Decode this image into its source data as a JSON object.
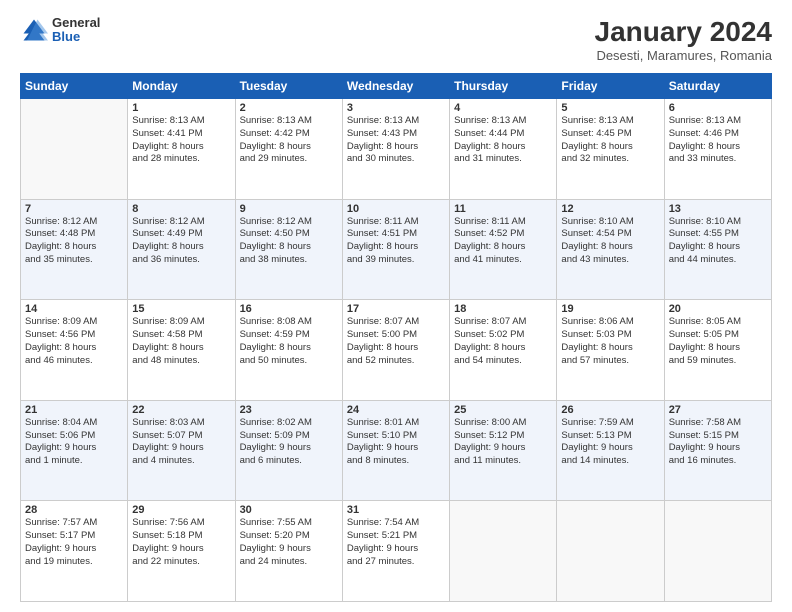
{
  "logo": {
    "general": "General",
    "blue": "Blue"
  },
  "title": "January 2024",
  "subtitle": "Desesti, Maramures, Romania",
  "weekdays": [
    "Sunday",
    "Monday",
    "Tuesday",
    "Wednesday",
    "Thursday",
    "Friday",
    "Saturday"
  ],
  "weeks": [
    [
      {
        "empty": true
      },
      {
        "day": "1",
        "sunrise": "8:13 AM",
        "sunset": "4:41 PM",
        "daylight": "8 hours and 28 minutes."
      },
      {
        "day": "2",
        "sunrise": "8:13 AM",
        "sunset": "4:42 PM",
        "daylight": "8 hours and 29 minutes."
      },
      {
        "day": "3",
        "sunrise": "8:13 AM",
        "sunset": "4:43 PM",
        "daylight": "8 hours and 30 minutes."
      },
      {
        "day": "4",
        "sunrise": "8:13 AM",
        "sunset": "4:44 PM",
        "daylight": "8 hours and 31 minutes."
      },
      {
        "day": "5",
        "sunrise": "8:13 AM",
        "sunset": "4:45 PM",
        "daylight": "8 hours and 32 minutes."
      },
      {
        "day": "6",
        "sunrise": "8:13 AM",
        "sunset": "4:46 PM",
        "daylight": "8 hours and 33 minutes."
      }
    ],
    [
      {
        "day": "7",
        "sunrise": "8:12 AM",
        "sunset": "4:48 PM",
        "daylight": "8 hours and 35 minutes."
      },
      {
        "day": "8",
        "sunrise": "8:12 AM",
        "sunset": "4:49 PM",
        "daylight": "8 hours and 36 minutes."
      },
      {
        "day": "9",
        "sunrise": "8:12 AM",
        "sunset": "4:50 PM",
        "daylight": "8 hours and 38 minutes."
      },
      {
        "day": "10",
        "sunrise": "8:11 AM",
        "sunset": "4:51 PM",
        "daylight": "8 hours and 39 minutes."
      },
      {
        "day": "11",
        "sunrise": "8:11 AM",
        "sunset": "4:52 PM",
        "daylight": "8 hours and 41 minutes."
      },
      {
        "day": "12",
        "sunrise": "8:10 AM",
        "sunset": "4:54 PM",
        "daylight": "8 hours and 43 minutes."
      },
      {
        "day": "13",
        "sunrise": "8:10 AM",
        "sunset": "4:55 PM",
        "daylight": "8 hours and 44 minutes."
      }
    ],
    [
      {
        "day": "14",
        "sunrise": "8:09 AM",
        "sunset": "4:56 PM",
        "daylight": "8 hours and 46 minutes."
      },
      {
        "day": "15",
        "sunrise": "8:09 AM",
        "sunset": "4:58 PM",
        "daylight": "8 hours and 48 minutes."
      },
      {
        "day": "16",
        "sunrise": "8:08 AM",
        "sunset": "4:59 PM",
        "daylight": "8 hours and 50 minutes."
      },
      {
        "day": "17",
        "sunrise": "8:07 AM",
        "sunset": "5:00 PM",
        "daylight": "8 hours and 52 minutes."
      },
      {
        "day": "18",
        "sunrise": "8:07 AM",
        "sunset": "5:02 PM",
        "daylight": "8 hours and 54 minutes."
      },
      {
        "day": "19",
        "sunrise": "8:06 AM",
        "sunset": "5:03 PM",
        "daylight": "8 hours and 57 minutes."
      },
      {
        "day": "20",
        "sunrise": "8:05 AM",
        "sunset": "5:05 PM",
        "daylight": "8 hours and 59 minutes."
      }
    ],
    [
      {
        "day": "21",
        "sunrise": "8:04 AM",
        "sunset": "5:06 PM",
        "daylight": "9 hours and 1 minute."
      },
      {
        "day": "22",
        "sunrise": "8:03 AM",
        "sunset": "5:07 PM",
        "daylight": "9 hours and 4 minutes."
      },
      {
        "day": "23",
        "sunrise": "8:02 AM",
        "sunset": "5:09 PM",
        "daylight": "9 hours and 6 minutes."
      },
      {
        "day": "24",
        "sunrise": "8:01 AM",
        "sunset": "5:10 PM",
        "daylight": "9 hours and 8 minutes."
      },
      {
        "day": "25",
        "sunrise": "8:00 AM",
        "sunset": "5:12 PM",
        "daylight": "9 hours and 11 minutes."
      },
      {
        "day": "26",
        "sunrise": "7:59 AM",
        "sunset": "5:13 PM",
        "daylight": "9 hours and 14 minutes."
      },
      {
        "day": "27",
        "sunrise": "7:58 AM",
        "sunset": "5:15 PM",
        "daylight": "9 hours and 16 minutes."
      }
    ],
    [
      {
        "day": "28",
        "sunrise": "7:57 AM",
        "sunset": "5:17 PM",
        "daylight": "9 hours and 19 minutes."
      },
      {
        "day": "29",
        "sunrise": "7:56 AM",
        "sunset": "5:18 PM",
        "daylight": "9 hours and 22 minutes."
      },
      {
        "day": "30",
        "sunrise": "7:55 AM",
        "sunset": "5:20 PM",
        "daylight": "9 hours and 24 minutes."
      },
      {
        "day": "31",
        "sunrise": "7:54 AM",
        "sunset": "5:21 PM",
        "daylight": "9 hours and 27 minutes."
      },
      {
        "empty": true
      },
      {
        "empty": true
      },
      {
        "empty": true
      }
    ]
  ],
  "labels": {
    "sunrise_prefix": "Sunrise: ",
    "sunset_prefix": "Sunset: ",
    "daylight_prefix": "Daylight: "
  }
}
